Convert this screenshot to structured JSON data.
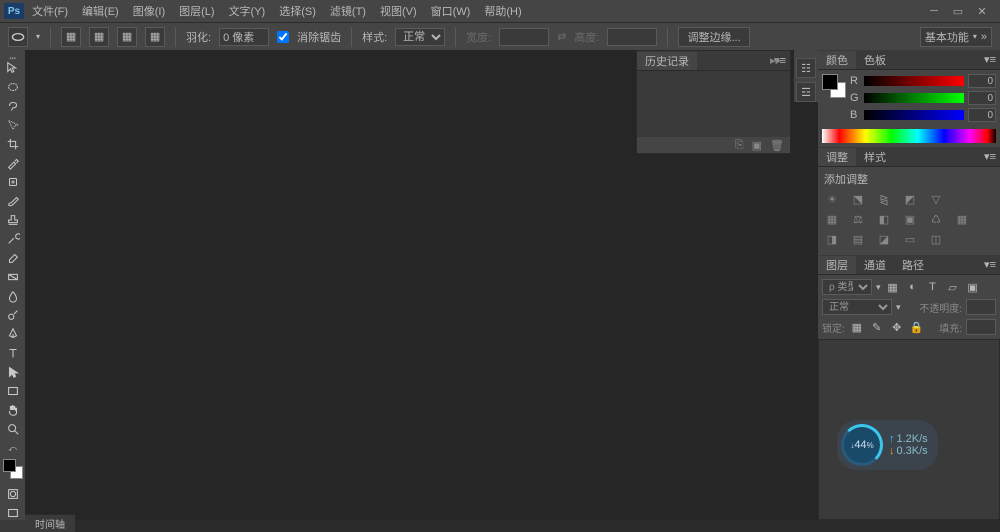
{
  "app": {
    "logo": "Ps"
  },
  "menu": [
    "文件(F)",
    "编辑(E)",
    "图像(I)",
    "图层(L)",
    "文字(Y)",
    "选择(S)",
    "滤镜(T)",
    "视图(V)",
    "窗口(W)",
    "帮助(H)"
  ],
  "options": {
    "feather_label": "羽化:",
    "feather_value": "0 像素",
    "antialias_label": "消除锯齿",
    "style_label": "样式:",
    "style_value": "正常",
    "width_label": "宽度:",
    "height_label": "高度:",
    "refine_label": "调整边缘...",
    "workspace": "基本功能"
  },
  "history": {
    "title": "历史记录"
  },
  "color_panel": {
    "tab1": "颜色",
    "tab2": "色板",
    "r": {
      "label": "R",
      "value": "0"
    },
    "g": {
      "label": "G",
      "value": "0"
    },
    "b": {
      "label": "B",
      "value": "0"
    }
  },
  "adjust_panel": {
    "tab1": "调整",
    "tab2": "样式",
    "add_label": "添加调整"
  },
  "layers_panel": {
    "tab1": "图层",
    "tab2": "通道",
    "tab3": "路径",
    "kind_label": "ρ 类型",
    "blend_value": "正常",
    "opacity_label": "不透明度:",
    "lock_label": "锁定:",
    "fill_label": "填充:"
  },
  "net": {
    "pct": "44",
    "pct_suffix": "%",
    "up": "1.2K/s",
    "dn": "0.3K/s"
  },
  "timeline": {
    "label": "时间轴"
  }
}
